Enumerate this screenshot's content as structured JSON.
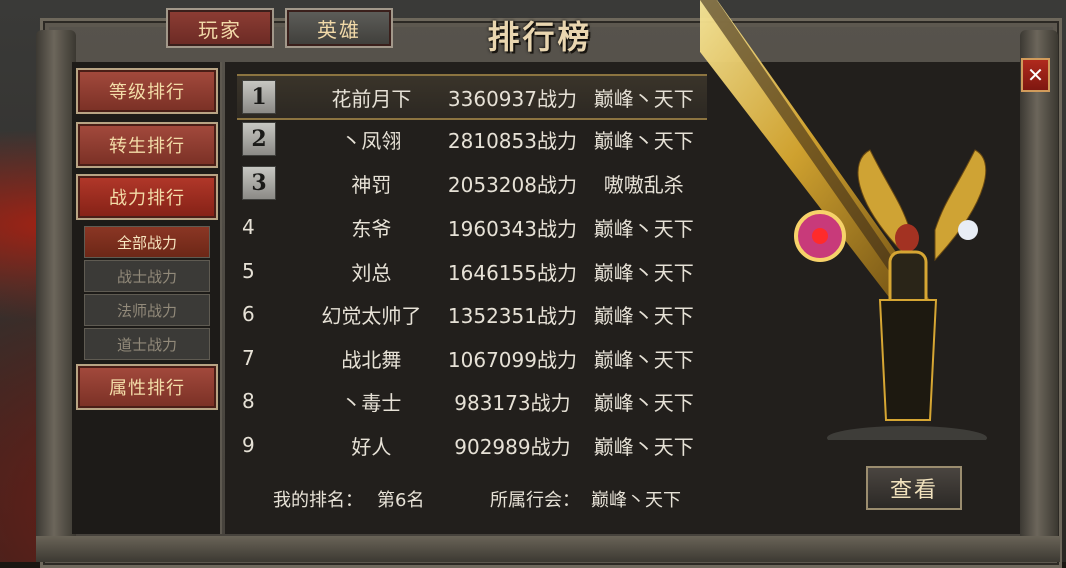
{
  "tabs": {
    "player": "玩家",
    "hero": "英雄"
  },
  "title": "排行榜",
  "close_icon_text": "✕",
  "sidebar": {
    "level_rank": "等级排行",
    "rebirth_rank": "转生排行",
    "power_rank": "战力排行",
    "sub": {
      "all": "全部战力",
      "warrior": "战士战力",
      "mage": "法师战力",
      "taoist": "道士战力"
    },
    "attr_rank": "属性排行"
  },
  "rows": [
    {
      "rank": "1",
      "name": "花前月下",
      "power": "3360937战力",
      "guild": "巅峰丶天下"
    },
    {
      "rank": "2",
      "name": "丶凤翎",
      "power": "2810853战力",
      "guild": "巅峰丶天下"
    },
    {
      "rank": "3",
      "name": "神罚",
      "power": "2053208战力",
      "guild": "嗷嗷乱杀"
    },
    {
      "rank": "4",
      "name": "东爷",
      "power": "1960343战力",
      "guild": "巅峰丶天下"
    },
    {
      "rank": "5",
      "name": "刘总",
      "power": "1646155战力",
      "guild": "巅峰丶天下"
    },
    {
      "rank": "6",
      "name": "幻觉太帅了",
      "power": "1352351战力",
      "guild": "巅峰丶天下"
    },
    {
      "rank": "7",
      "name": "战北舞",
      "power": "1067099战力",
      "guild": "巅峰丶天下"
    },
    {
      "rank": "8",
      "name": "丶毒士",
      "power": "983173战力",
      "guild": "巅峰丶天下"
    },
    {
      "rank": "9",
      "name": "好人",
      "power": "902989战力",
      "guild": "巅峰丶天下"
    }
  ],
  "footer": {
    "my_rank_label": "我的排名：",
    "my_rank_value": "第6名",
    "guild_label": "所属行会：",
    "guild_value": "巅峰丶天下"
  },
  "view_button": "查看",
  "colors": {
    "accent_red": "#8d3d34",
    "gold": "#d8b24a",
    "text": "#e6e1d6"
  }
}
